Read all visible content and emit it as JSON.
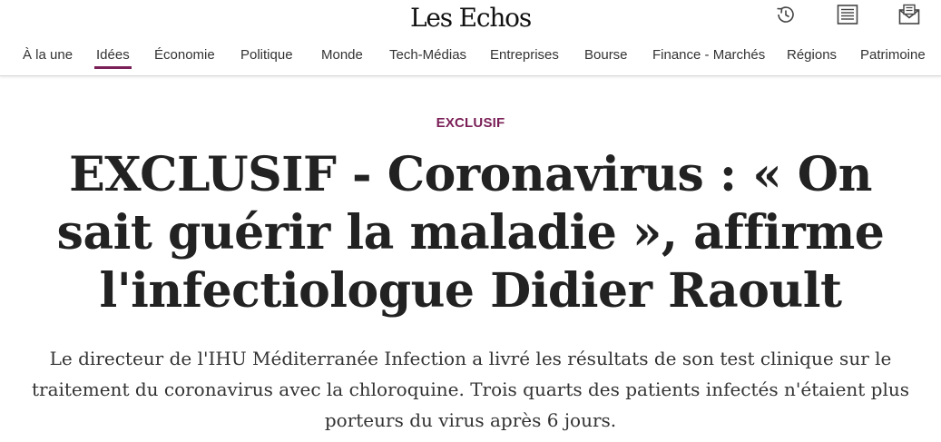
{
  "header": {
    "logo": "Les Echos",
    "icons": [
      "history-icon",
      "newspaper-icon",
      "newsletter-icon"
    ]
  },
  "nav": {
    "items": [
      {
        "label": "À la une"
      },
      {
        "label": "Idées"
      },
      {
        "label": "Économie"
      },
      {
        "label": "Politique"
      },
      {
        "label": "Monde"
      },
      {
        "label": "Tech-Médias"
      },
      {
        "label": "Entreprises"
      },
      {
        "label": "Bourse"
      },
      {
        "label": "Finance - Marchés"
      },
      {
        "label": "Régions"
      },
      {
        "label": "Patrimoine"
      }
    ],
    "active_item": "Idées"
  },
  "article": {
    "kicker": "EXCLUSIF",
    "headline": "EXCLUSIF - Coronavirus : « On sait guérir la maladie », affirme l'infectiologue Didier Raoult",
    "standfirst": "Le directeur de l'IHU Méditerranée Infection a livré les résultats de son test clinique sur le traitement du coronavirus avec la chloroquine. Trois quarts des patients infectés n'étaient plus porteurs du virus après 6 jours."
  },
  "colors": {
    "accent": "#7a1f57",
    "text": "#222222",
    "nav_text": "#333333"
  }
}
